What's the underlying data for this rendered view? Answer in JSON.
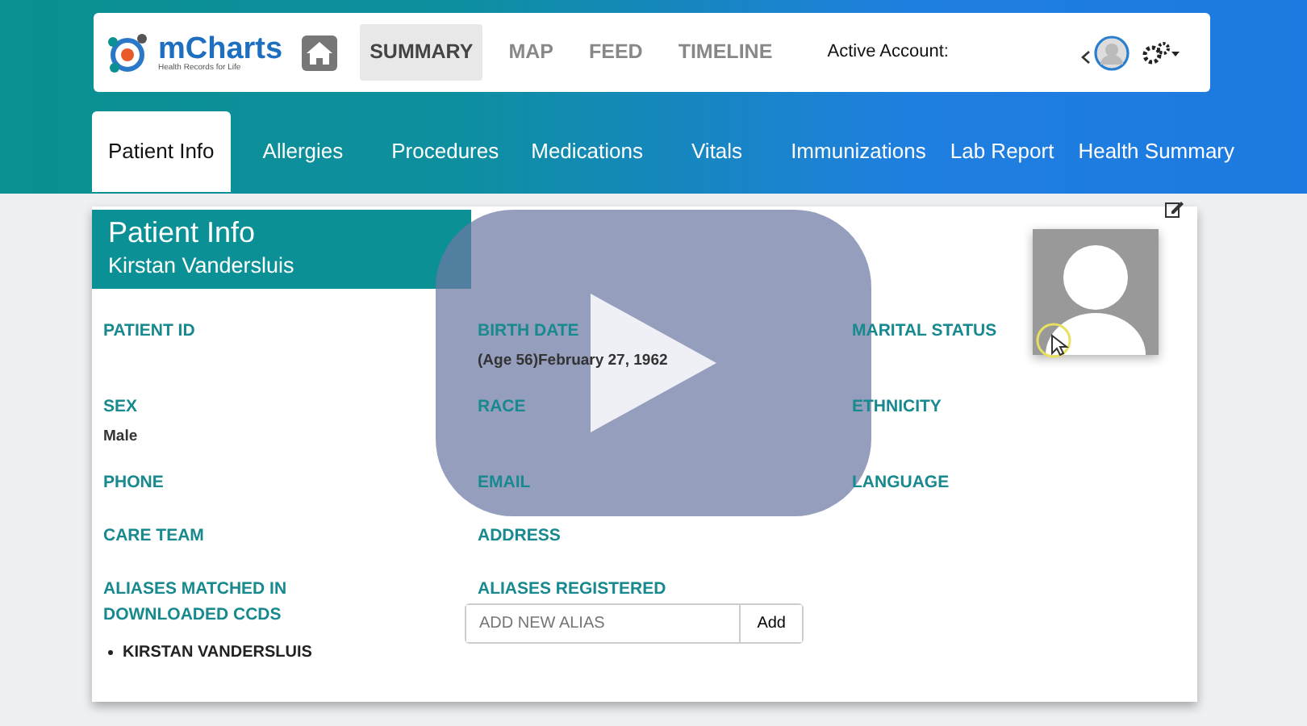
{
  "navbar": {
    "logo": "mCharts",
    "tagline": "Health Records for Life",
    "items": [
      {
        "label": "SUMMARY",
        "selected": true
      },
      {
        "label": "MAP",
        "selected": false
      },
      {
        "label": "FEED",
        "selected": false
      },
      {
        "label": "TIMELINE",
        "selected": false
      }
    ],
    "account_label": "Active Account:"
  },
  "tabs": [
    {
      "label": "Patient Info",
      "selected": true
    },
    {
      "label": "Allergies",
      "selected": false
    },
    {
      "label": "Procedures",
      "selected": false
    },
    {
      "label": "Medications",
      "selected": false
    },
    {
      "label": "Vitals",
      "selected": false
    },
    {
      "label": "Immunizations",
      "selected": false
    },
    {
      "label": "Lab Report",
      "selected": false
    },
    {
      "label": "Health Summary",
      "selected": false
    }
  ],
  "patient": {
    "title": "Patient Info",
    "name": "Kirstan Vandersluis",
    "fields": [
      {
        "label": "PATIENT ID"
      },
      {
        "label": "BIRTH DATE",
        "value": "**(Age 56)**February 27, 1962"
      },
      {
        "label": "MARITAL STATUS"
      },
      {
        "label": "SEX",
        "value": "Male"
      },
      {
        "label": "RACE"
      },
      {
        "label": "ETHNICITY"
      },
      {
        "label": "PHONE"
      },
      {
        "label": "EMAIL"
      },
      {
        "label": "LANGUAGE"
      },
      {
        "label": "CARE TEAM"
      },
      {
        "label": "ADDRESS"
      }
    ],
    "aliases_matched": {
      "label": "ALIASES MATCHED IN DOWNLOADED CCDS",
      "items": [
        "KIRSTAN VANDERSLUIS"
      ]
    },
    "aliases_registered": {
      "label": "ALIASES REGISTERED",
      "placeholder": "ADD NEW ALIAS",
      "button": "Add"
    }
  }
}
